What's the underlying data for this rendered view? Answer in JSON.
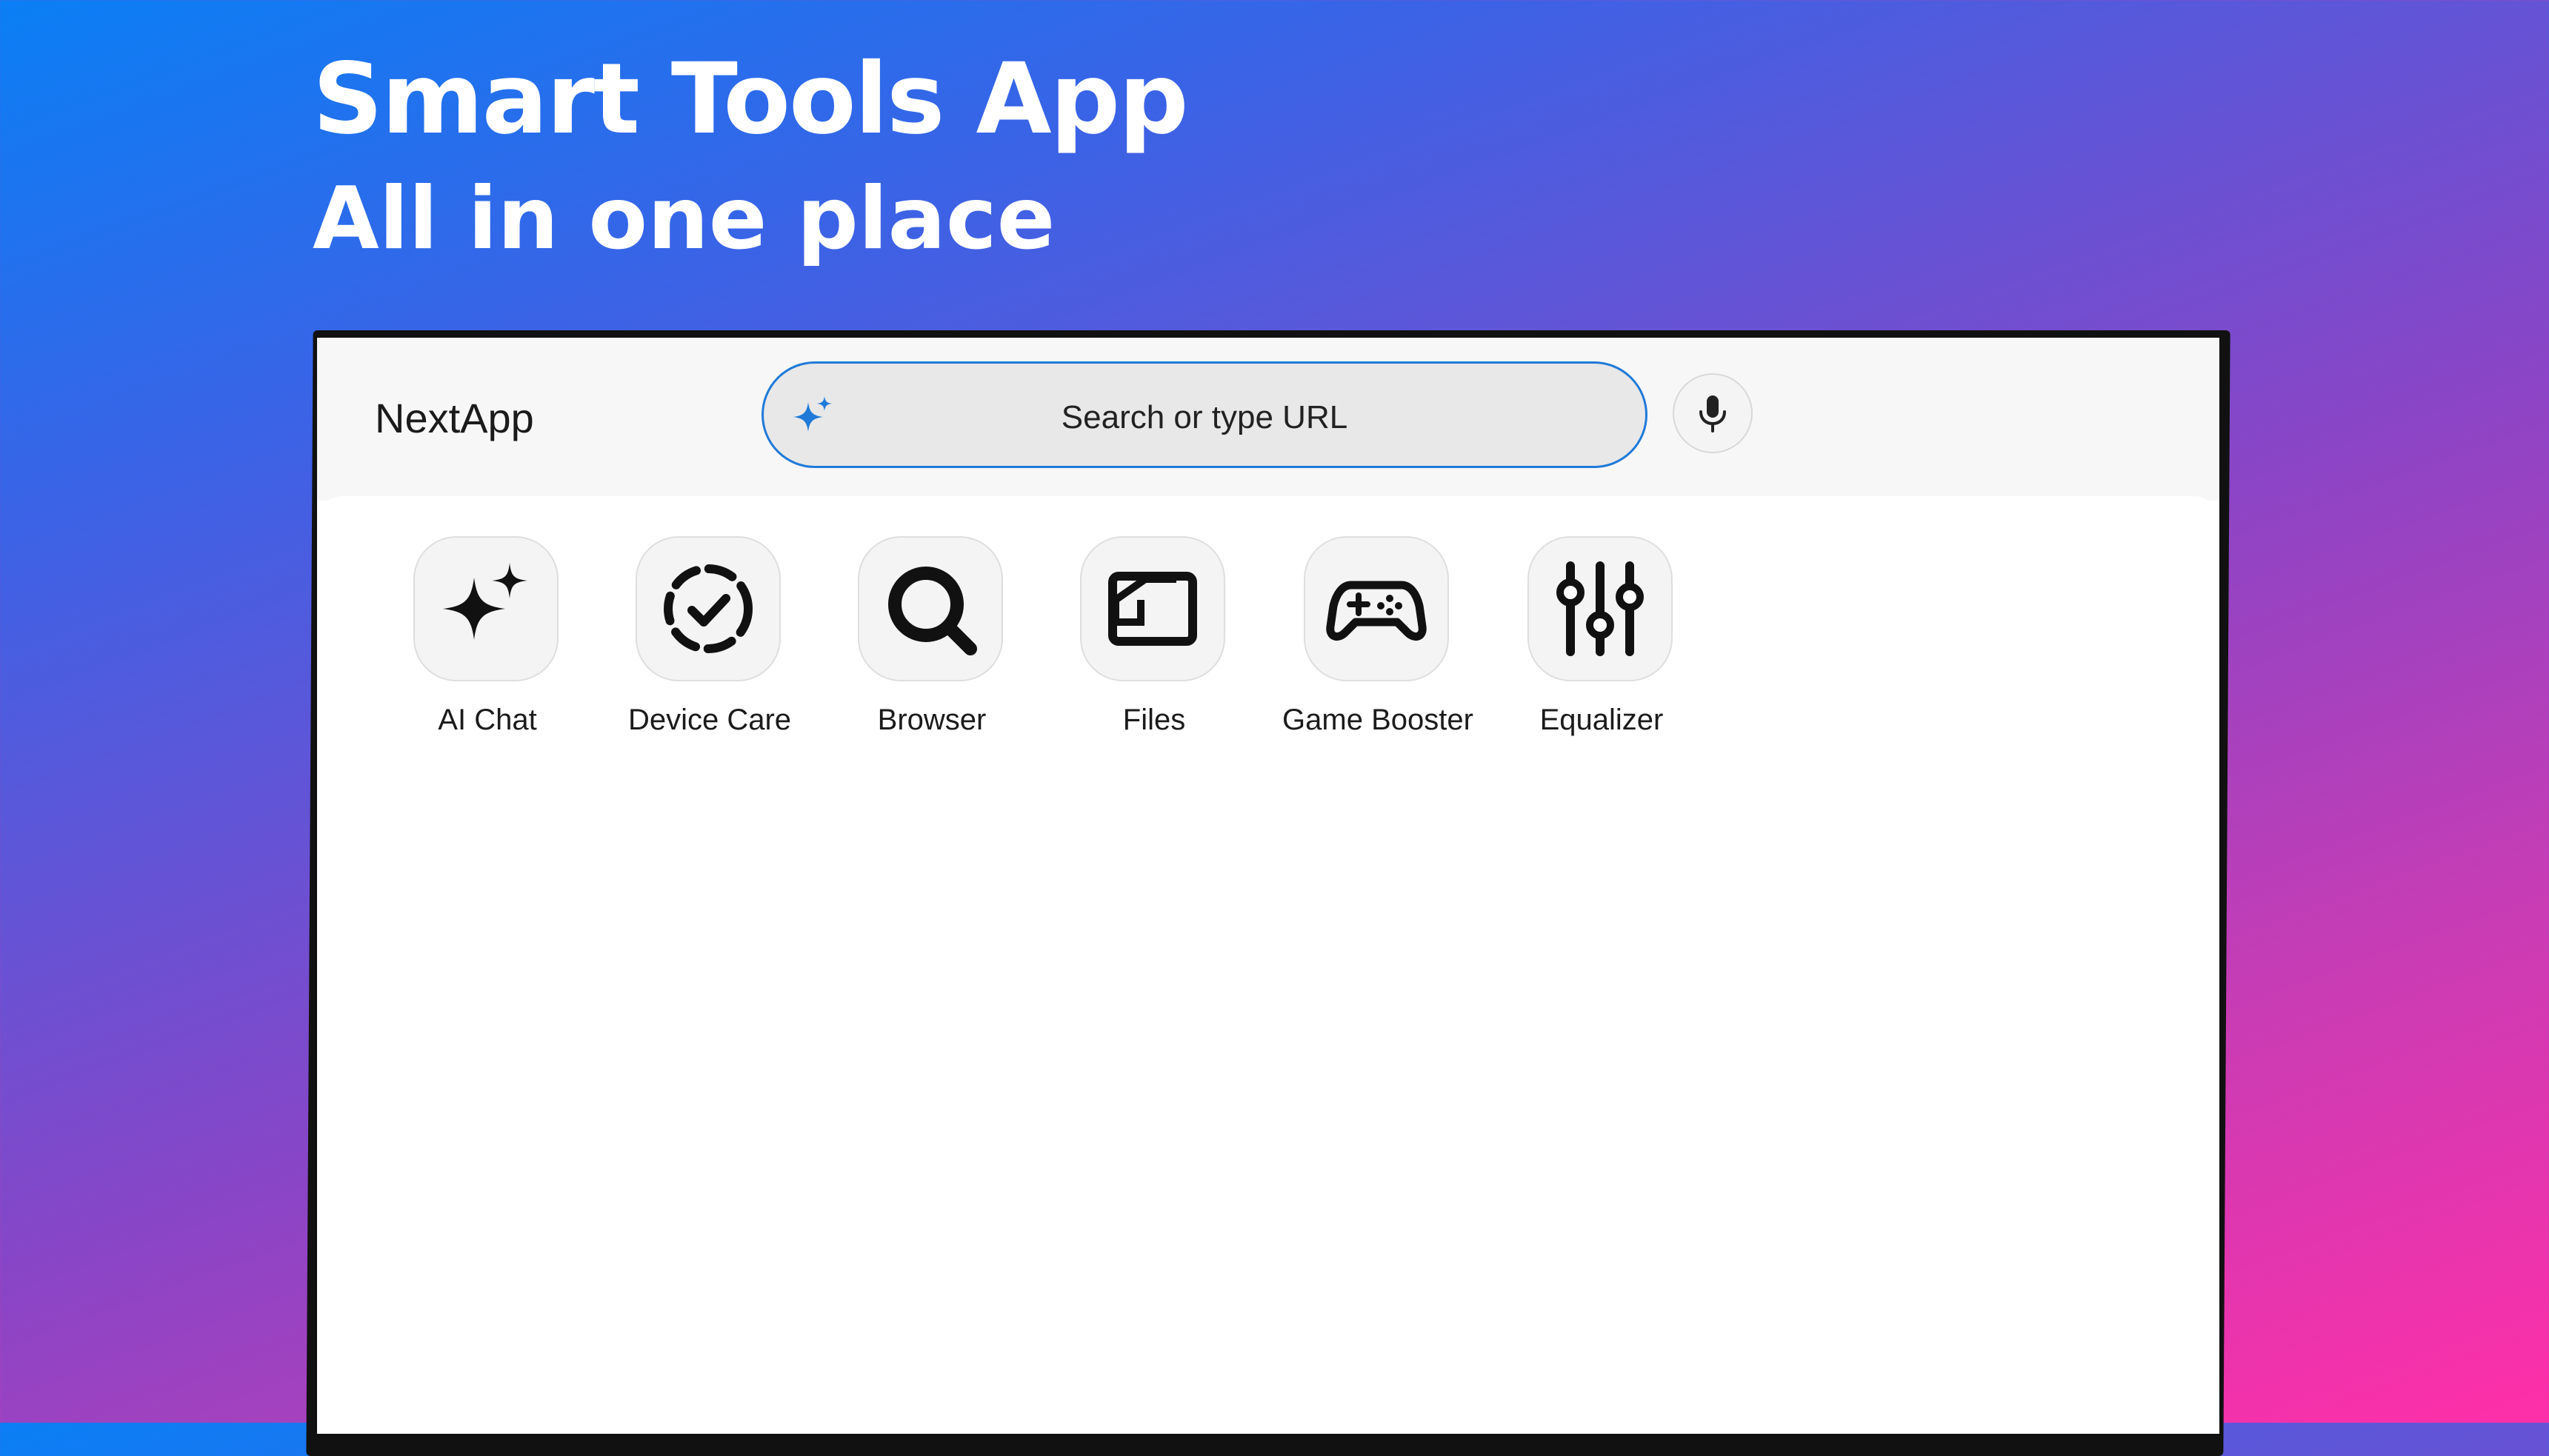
{
  "promo": {
    "title": "Smart Tools App",
    "subtitle": "All in one place"
  },
  "app": {
    "name": "NextApp"
  },
  "search": {
    "placeholder": "Search or type URL",
    "leading_icon": "sparkle-icon",
    "accent_color": "#1f7ad8"
  },
  "mic": {
    "icon": "microphone-icon"
  },
  "tools": [
    {
      "label": "AI Chat",
      "icon": "sparkle-icon"
    },
    {
      "label": "Device Care",
      "icon": "circle-check-dashed-icon"
    },
    {
      "label": "Browser",
      "icon": "search-icon"
    },
    {
      "label": "Files",
      "icon": "folder-icon"
    },
    {
      "label": "Game Booster",
      "icon": "gamepad-icon"
    },
    {
      "label": "Equalizer",
      "icon": "sliders-icon"
    }
  ],
  "colors": {
    "gradient_start": "#0a7ff5",
    "gradient_end": "#ff2fa8"
  }
}
